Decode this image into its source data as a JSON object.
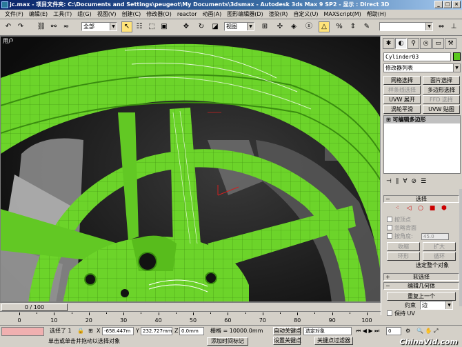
{
  "window": {
    "title": "jc.max  -  项目文件夹: C:\\Documents and Settings\\peugeot\\My Documents\\3dsmax  -  Autodesk 3ds Max 9 SP2  -  显示 : Direct 3D"
  },
  "menu": [
    "文件(F)",
    "编辑(E)",
    "工具(T)",
    "组(G)",
    "视图(V)",
    "创建(C)",
    "修改器(O)",
    "reactor",
    "动画(A)",
    "图形编辑器(D)",
    "渲染(R)",
    "自定义(U)",
    "MAXScript(M)",
    "帮助(H)"
  ],
  "toolbar": {
    "selection_filter": "全部",
    "ref_coord": "视图"
  },
  "viewport": {
    "label": "用户"
  },
  "command_panel": {
    "object_name": "Cylinder03",
    "object_color": "#5ac81e",
    "modifier_list": "修改器列表",
    "buttons": [
      "网格选择",
      "面片选择",
      "样条线选择",
      "多边形选择",
      "UVW 展开",
      "FFD 选择",
      "涡轮平滑",
      "UVW 贴图"
    ],
    "stack_item": "可编辑多边形",
    "rollout_selection": "选择",
    "by_vertex": "按顶点",
    "ignore_backfacing": "忽略背面",
    "by_angle": "按角度:",
    "angle_value": "45.0",
    "shrink": "收缩",
    "grow": "扩大",
    "ring": "环形",
    "loop": "循环",
    "selected_info": "选定整个对象",
    "rollout_soft": "软选择",
    "rollout_geometry": "编辑几何体",
    "repeat_last": "重复上一个",
    "constraints_label": "约束",
    "constraints_value": "边",
    "preserve_uv": "保持 UV"
  },
  "timeline": {
    "frame_label": "0 / 100",
    "ticks": [
      0,
      10,
      20,
      30,
      40,
      50,
      60,
      70,
      80,
      90,
      100
    ]
  },
  "status": {
    "selected": "选择了 1",
    "x": "-658.447m",
    "y": "232.727mm",
    "z": "0.0mm",
    "grid": "栅格 = 10000.0mm",
    "auto_key": "自动关键点",
    "selected_obj": "选定对象",
    "set_key": "设置关键点",
    "key_filter": "关键点过滤器",
    "prompt": "单击或单击并拖动以选择对象",
    "add_time_tag": "添加时间标记",
    "frame": "0"
  },
  "watermark": "ChinaVid.com"
}
